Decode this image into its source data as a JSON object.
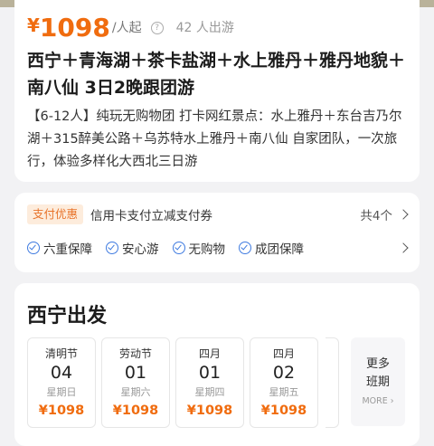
{
  "product": {
    "currency": "¥",
    "price": "1098",
    "price_unit": "/人起",
    "info_icon_glyph": "?",
    "travelers": "42 人出游",
    "title": "西宁＋青海湖＋茶卡盐湖＋水上雅丹＋雅丹地貌＋南八仙 3日2晚跟团游",
    "description": "【6-12人】纯玩无购物团 打卡网红景点：水上雅丹＋东台吉乃尔湖＋315醉美公路＋乌苏特水上雅丹＋南八仙 自家团队，一次旅行，体验多样化大西北三日游"
  },
  "promo": {
    "tag": "支付优惠",
    "text": "信用卡支付立减支付券",
    "count": "共4个"
  },
  "guarantees": [
    "六重保障",
    "安心游",
    "无购物",
    "成团保障"
  ],
  "departure": {
    "title": "西宁出发",
    "dates": [
      {
        "label": "清明节",
        "day": "04",
        "weekday": "星期日",
        "price": "¥1098"
      },
      {
        "label": "劳动节",
        "day": "01",
        "weekday": "星期六",
        "price": "¥1098"
      },
      {
        "label": "四月",
        "day": "01",
        "weekday": "星期四",
        "price": "¥1098"
      },
      {
        "label": "四月",
        "day": "02",
        "weekday": "星期五",
        "price": "¥1098"
      }
    ],
    "more_line1": "更多",
    "more_line2": "班期",
    "more_en": "MORE ›"
  },
  "colors": {
    "accent": "#f06c0f",
    "check": "#3f7be0",
    "promo_tag_bg": "#fdecdc"
  },
  "icons": {
    "info": "info-icon",
    "check": "check-circle-icon",
    "chevron": "chevron-right-icon"
  }
}
